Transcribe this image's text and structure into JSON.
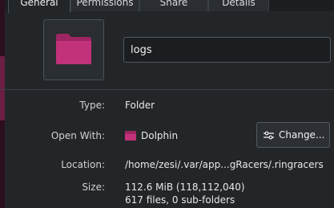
{
  "tabs": [
    {
      "label": "General",
      "active": true
    },
    {
      "label": "Permissions",
      "active": false
    },
    {
      "label": "Share",
      "active": false
    },
    {
      "label": "Details",
      "active": false
    }
  ],
  "folder_icon": {
    "name": "folder-icon",
    "color": "#c2327a"
  },
  "name_field": {
    "value": "logs"
  },
  "properties": {
    "type": {
      "label": "Type:",
      "value": "Folder"
    },
    "open_with": {
      "label": "Open With:",
      "app_name": "Dolphin",
      "app_icon": "dolphin-icon",
      "change_label": "Change..."
    },
    "location": {
      "label": "Location:",
      "value": "/home/zesi/.var/app...gRacers/.ringracers"
    },
    "size": {
      "label": "Size:",
      "value": "112.6 MiB (118,112,040)",
      "detail": "617 files, 0 sub-folders"
    }
  },
  "colors": {
    "background": "#232629",
    "accent": "#c2327a",
    "edge": "#2c0f1e"
  }
}
